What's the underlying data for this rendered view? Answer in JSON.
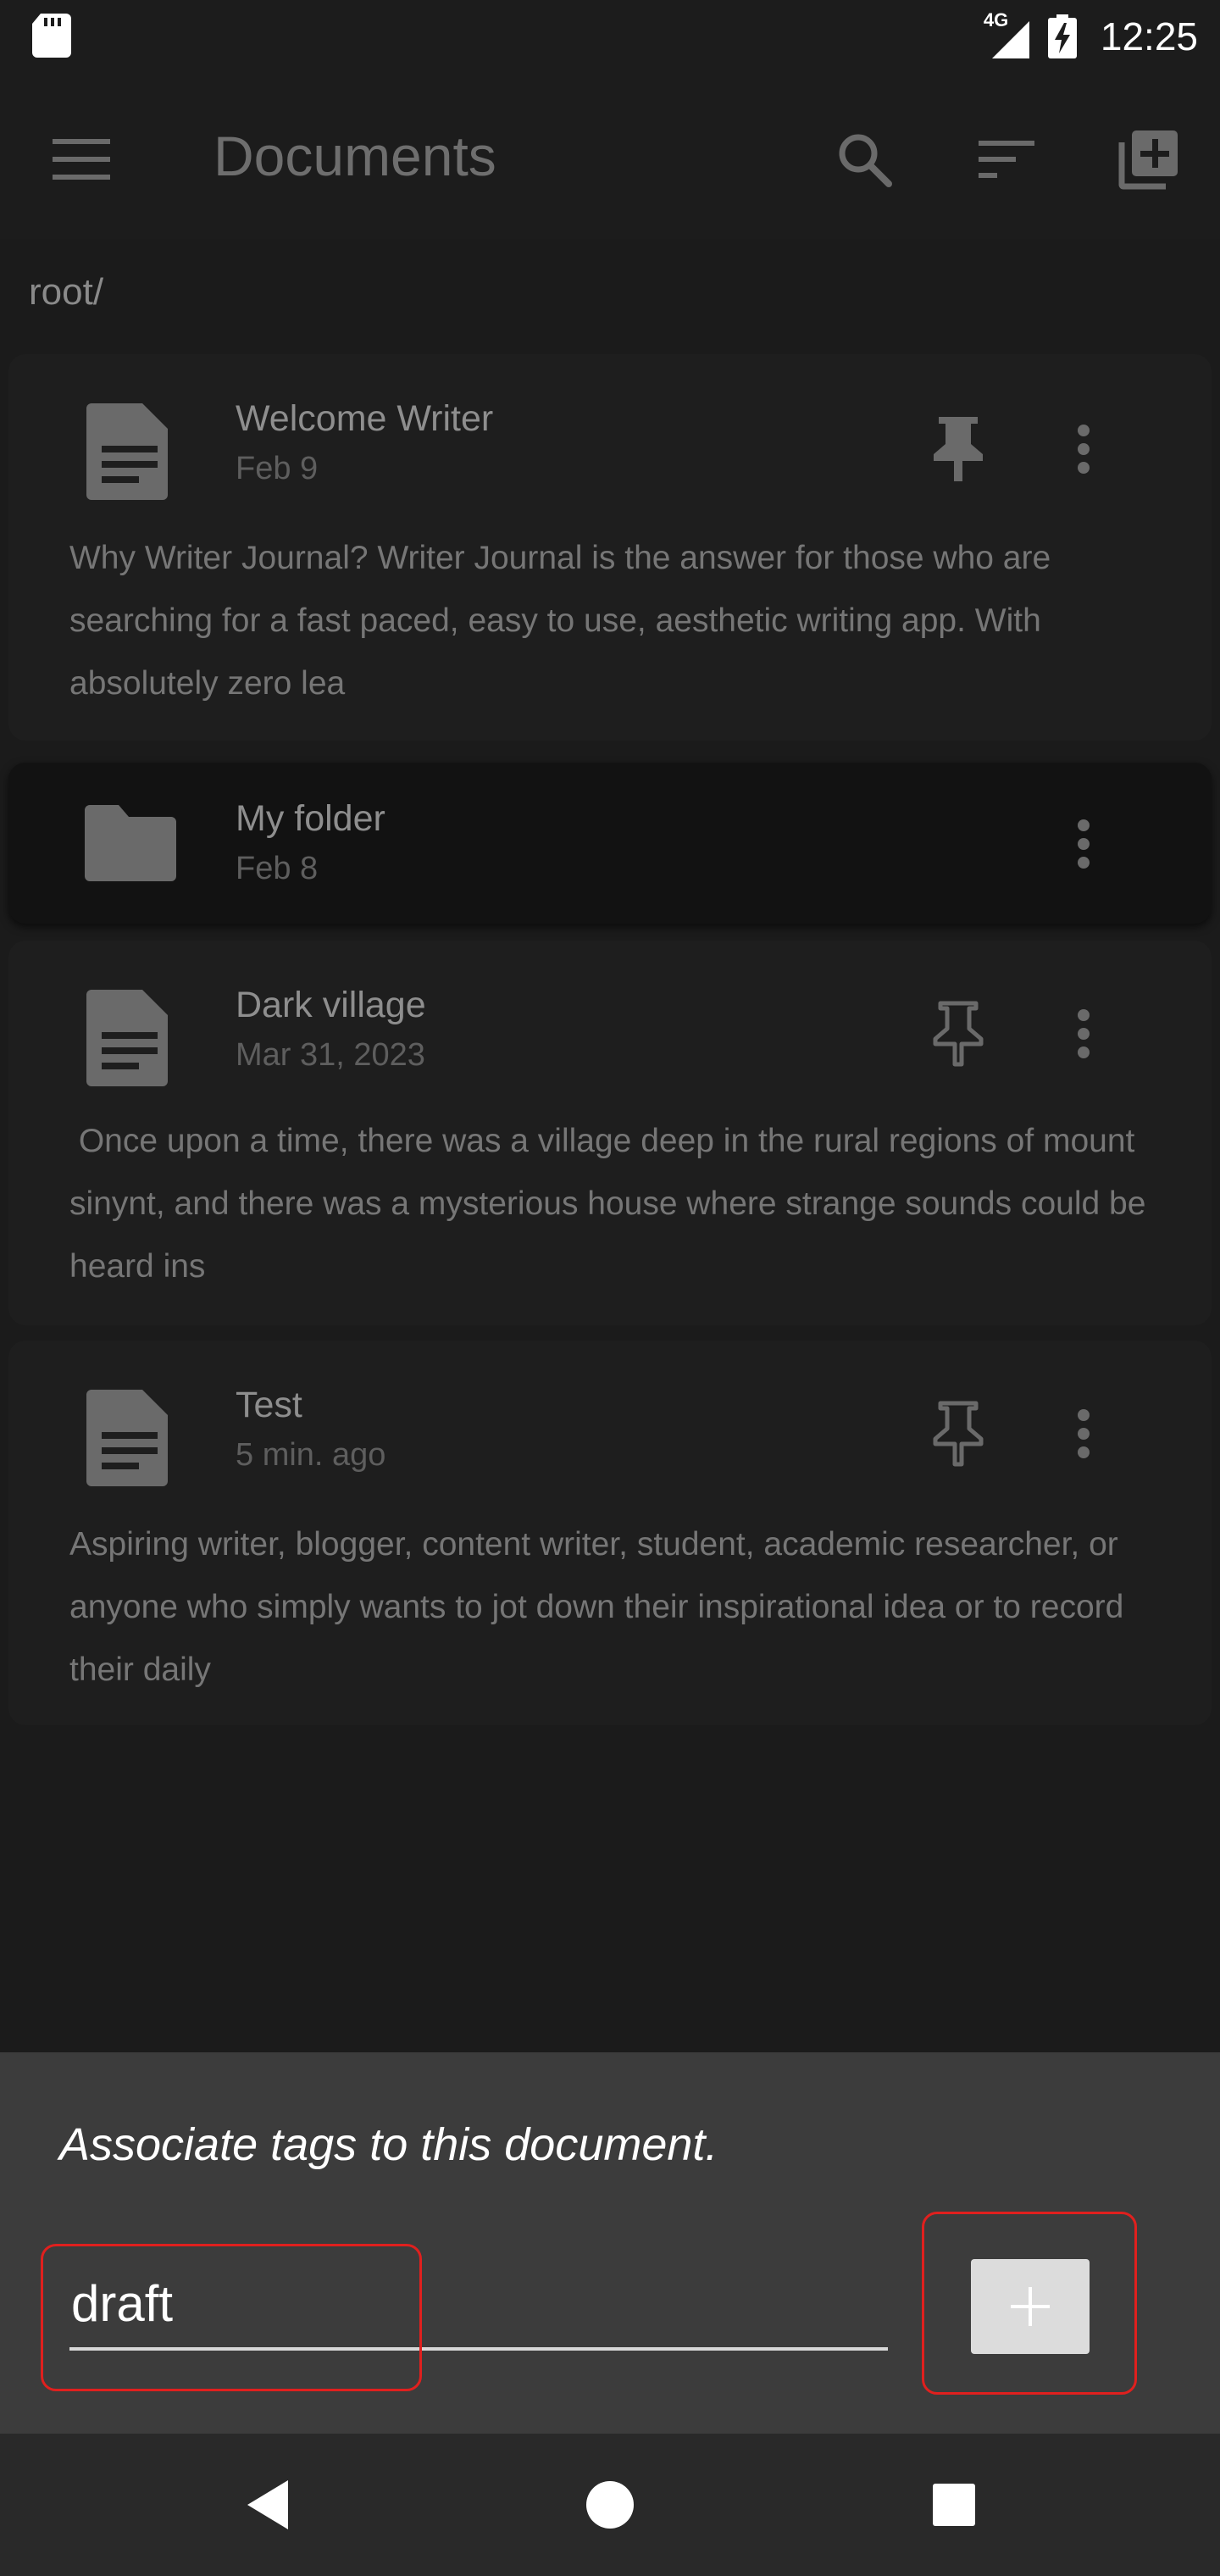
{
  "status_bar": {
    "network": "4G",
    "time": "12:25"
  },
  "app_bar": {
    "title": "Documents"
  },
  "breadcrumb": "root/",
  "items": [
    {
      "type": "document",
      "title": "Welcome Writer",
      "date": "Feb 9",
      "pinned": true,
      "preview": "Why Writer Journal? Writer Journal is the answer for those who are searching for a fast paced, easy to use, aesthetic writing app. With absolutely zero lea"
    },
    {
      "type": "folder",
      "title": "My folder",
      "date": "Feb 8"
    },
    {
      "type": "document",
      "title": "Dark village",
      "date": "Mar 31, 2023",
      "pinned": false,
      "preview": " Once upon a time, there was a village deep in the rural regions of mount sinynt, and there was a mysterious house where strange sounds could be heard ins"
    },
    {
      "type": "document",
      "title": "Test",
      "date": "5 min. ago",
      "pinned": false,
      "preview": "Aspiring writer, blogger, content writer, student, academic researcher, or anyone who simply wants to jot down their inspirational idea or to record their daily"
    }
  ],
  "tag_sheet": {
    "prompt": "Associate tags to this document.",
    "input_value": "draft",
    "add_button_label": "+"
  },
  "colors": {
    "background": "#1b1b1b",
    "sheet": "#3c3c3c",
    "highlight": "#e0201e"
  }
}
